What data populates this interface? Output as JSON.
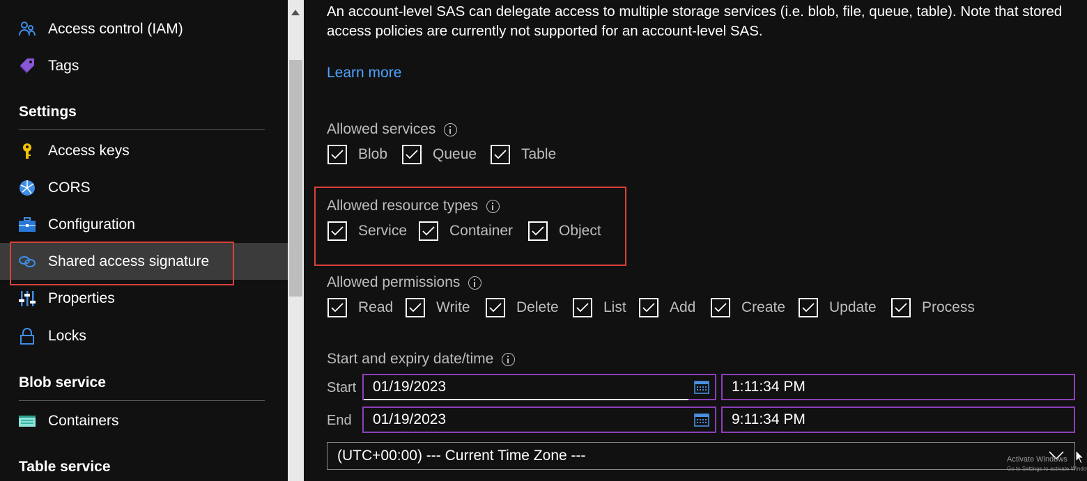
{
  "sidebar": {
    "items": [
      {
        "label": "Access control (IAM)",
        "icon": "people-icon"
      },
      {
        "label": "Tags",
        "icon": "tag-icon"
      },
      {
        "label": "Access keys",
        "icon": "key-icon"
      },
      {
        "label": "CORS",
        "icon": "globe-icon"
      },
      {
        "label": "Configuration",
        "icon": "toolbox-icon"
      },
      {
        "label": "Shared access signature",
        "icon": "link-icon",
        "selected": true
      },
      {
        "label": "Properties",
        "icon": "sliders-icon"
      },
      {
        "label": "Locks",
        "icon": "lock-icon"
      },
      {
        "label": "Containers",
        "icon": "container-icon"
      }
    ],
    "sections": {
      "settings": "Settings",
      "blob_service": "Blob service",
      "table_service": "Table service"
    }
  },
  "main": {
    "intro_text": "An account-level SAS can delegate access to multiple storage services (i.e. blob, file, queue, table). Note that stored access policies are currently not supported for an account-level SAS.",
    "learn_more": "Learn more",
    "allowed_services": {
      "label": "Allowed services",
      "options": [
        {
          "label": "Blob",
          "checked": true
        },
        {
          "label": "Queue",
          "checked": true
        },
        {
          "label": "Table",
          "checked": true
        }
      ]
    },
    "allowed_resource_types": {
      "label": "Allowed resource types",
      "options": [
        {
          "label": "Service",
          "checked": true
        },
        {
          "label": "Container",
          "checked": true
        },
        {
          "label": "Object",
          "checked": true
        }
      ]
    },
    "allowed_permissions": {
      "label": "Allowed permissions",
      "options": [
        {
          "label": "Read",
          "checked": true
        },
        {
          "label": "Write",
          "checked": true
        },
        {
          "label": "Delete",
          "checked": true
        },
        {
          "label": "List",
          "checked": true
        },
        {
          "label": "Add",
          "checked": true
        },
        {
          "label": "Create",
          "checked": true
        },
        {
          "label": "Update",
          "checked": true
        },
        {
          "label": "Process",
          "checked": true
        }
      ]
    },
    "datetime": {
      "label": "Start and expiry date/time",
      "start_label": "Start",
      "end_label": "End",
      "start_date": "01/19/2023",
      "start_time": "1:11:34 PM",
      "end_date": "01/19/2023",
      "end_time": "9:11:34 PM",
      "timezone": "(UTC+00:00) --- Current Time Zone ---"
    }
  },
  "watermark": {
    "line1": "Activate Windows",
    "line2": "Go to Settings to activate Windows."
  },
  "colors": {
    "background": "#111111",
    "link": "#4da3ff",
    "highlight": "#d9413a",
    "field_border": "#8c3fb8",
    "selected_item": "#3b3b3b"
  }
}
